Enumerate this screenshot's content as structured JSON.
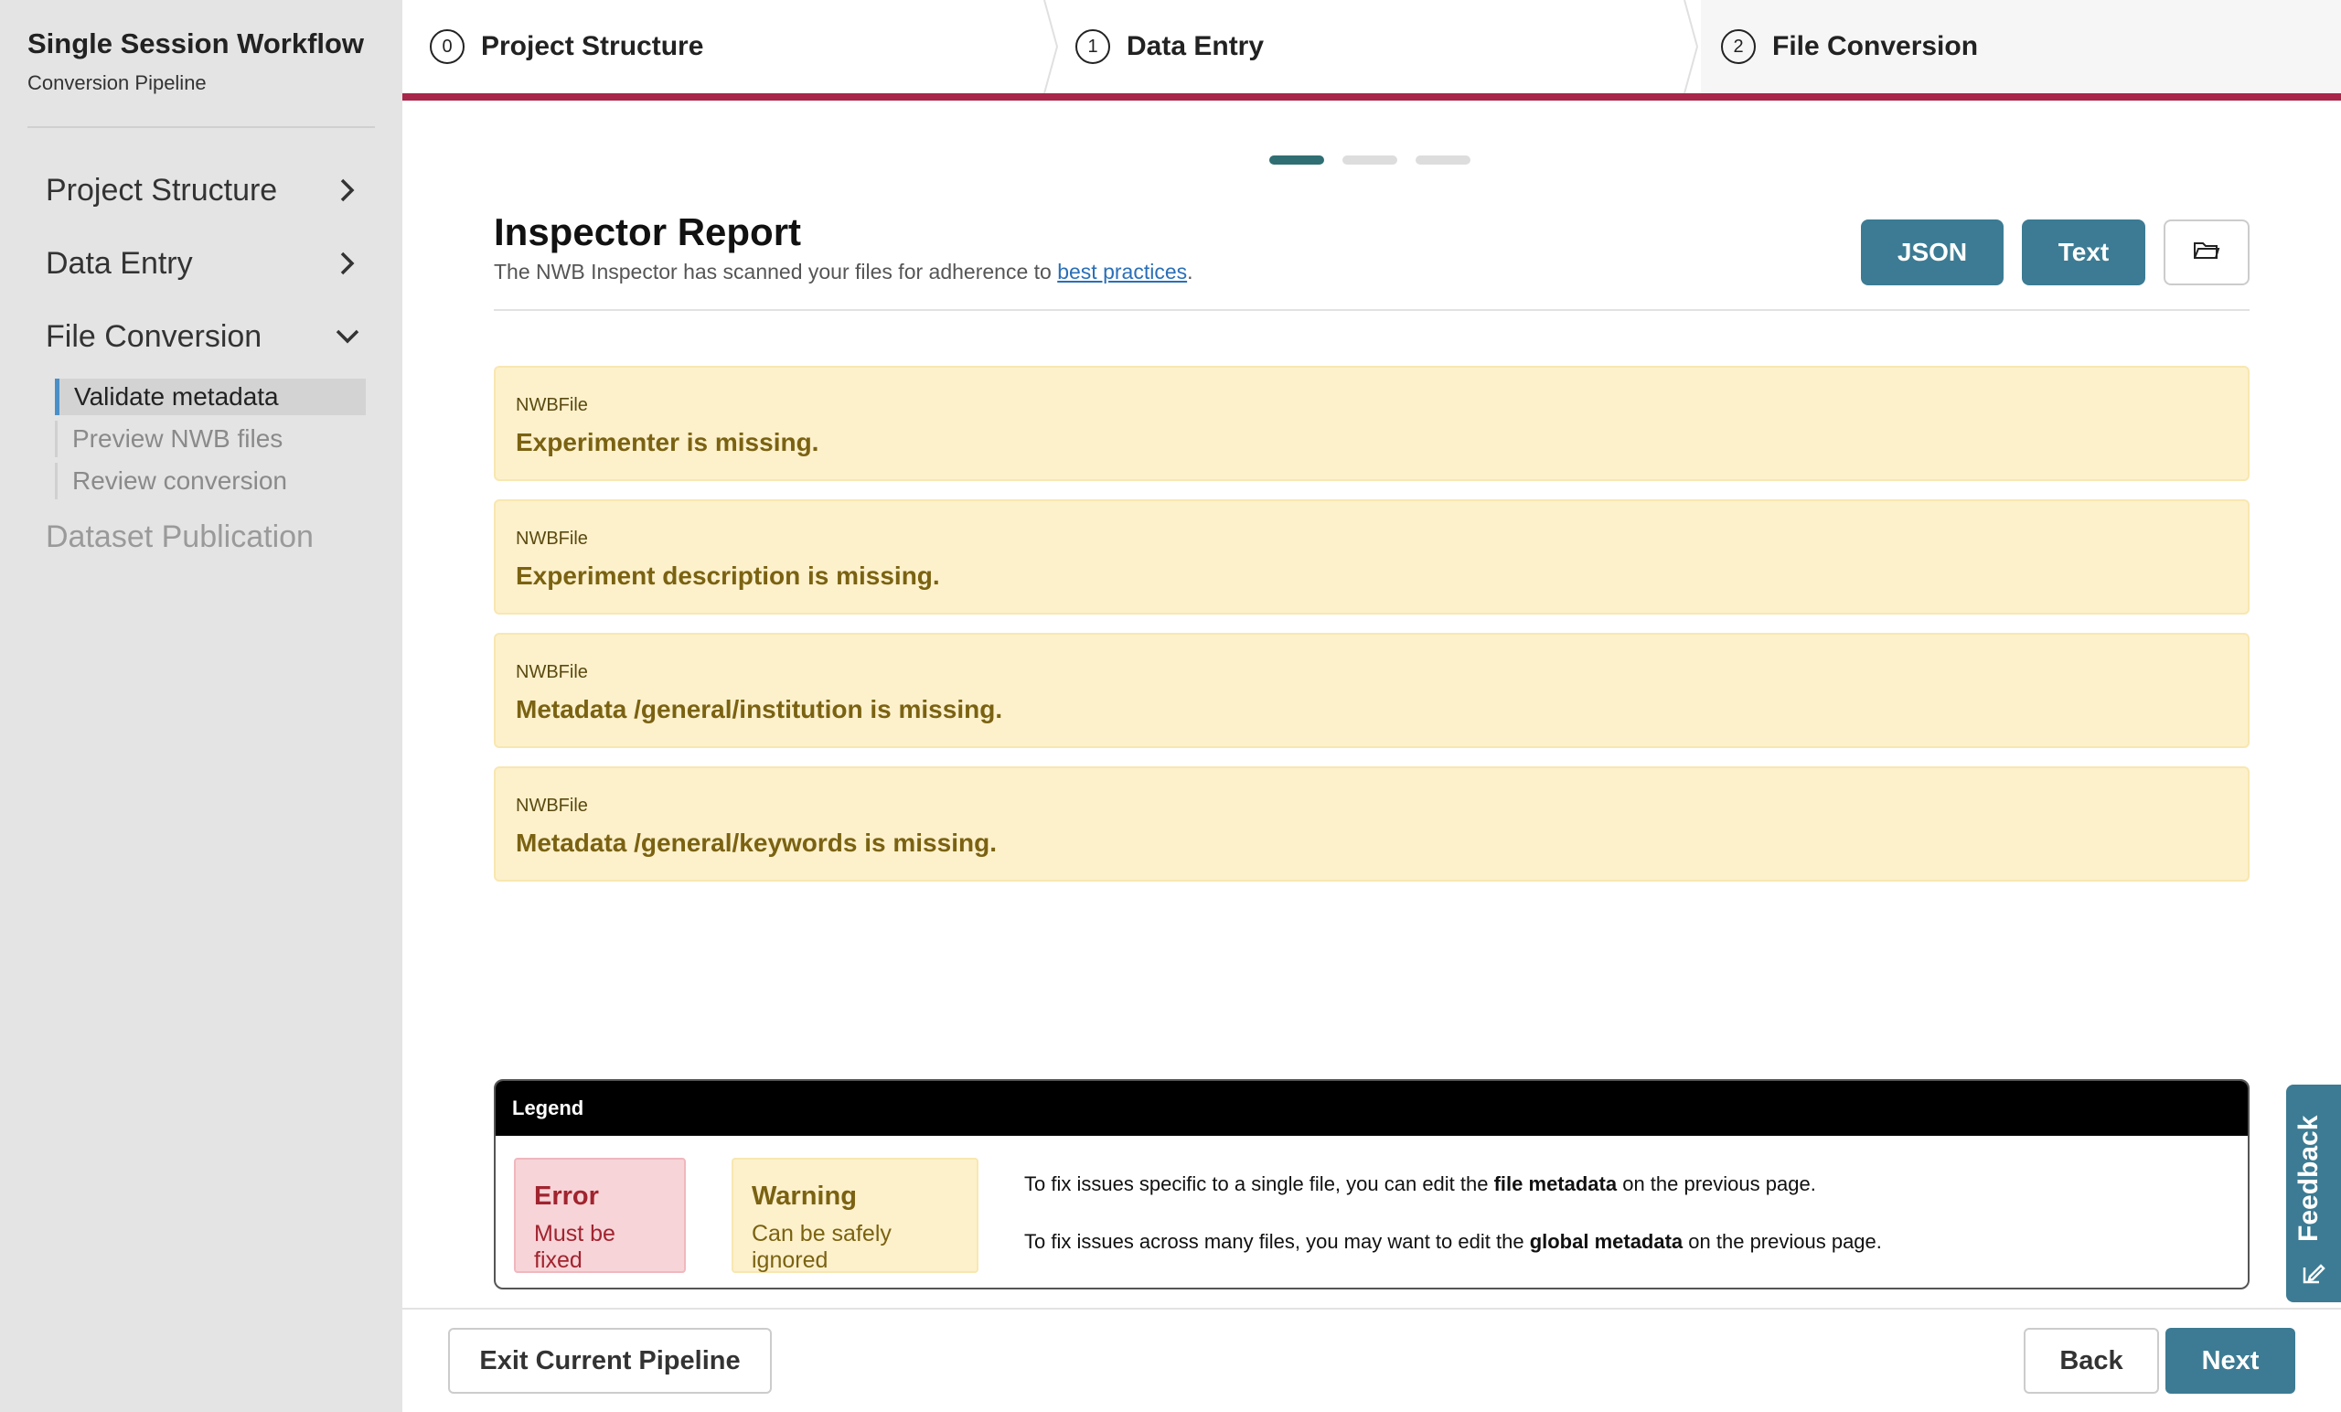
{
  "sidebar": {
    "title": "Single Session Workflow",
    "subtitle": "Conversion Pipeline",
    "items": [
      {
        "label": "Project Structure"
      },
      {
        "label": "Data Entry"
      },
      {
        "label": "File Conversion"
      },
      {
        "label": "Dataset Publication"
      }
    ],
    "sub_items": [
      {
        "label": "Validate metadata"
      },
      {
        "label": "Preview NWB files"
      },
      {
        "label": "Review conversion"
      }
    ]
  },
  "stepper": {
    "steps": [
      {
        "num": "0",
        "label": "Project Structure"
      },
      {
        "num": "1",
        "label": "Data Entry"
      },
      {
        "num": "2",
        "label": "File Conversion"
      }
    ],
    "accent_color": "#a8264a"
  },
  "report": {
    "title": "Inspector Report",
    "description_prefix": "The NWB Inspector has scanned your files for adherence to ",
    "description_link": "best practices",
    "description_suffix": ".",
    "json_button": "JSON",
    "text_button": "Text",
    "folder_icon": "folder-icon"
  },
  "messages": [
    {
      "type": "NWBFile",
      "text": "Experimenter is missing."
    },
    {
      "type": "NWBFile",
      "text": "Experiment description is missing."
    },
    {
      "type": "NWBFile",
      "text": "Metadata /general/institution is missing."
    },
    {
      "type": "NWBFile",
      "text": "Metadata /general/keywords is missing."
    }
  ],
  "legend": {
    "title": "Legend",
    "error_title": "Error",
    "error_sub": "Must be fixed",
    "warning_title": "Warning",
    "warning_sub": "Can be safely ignored",
    "info1_prefix": "To fix issues specific to a single file, you can edit the ",
    "info1_bold": "file metadata",
    "info1_suffix": " on the previous page.",
    "info2_prefix": "To fix issues across many files, you may want to edit the ",
    "info2_bold": "global metadata",
    "info2_suffix": " on the previous page."
  },
  "footer": {
    "exit_label": "Exit Current Pipeline",
    "back_label": "Back",
    "next_label": "Next"
  },
  "feedback": {
    "label": "Feedback"
  },
  "colors": {
    "teal": "#3c7b93",
    "warning_bg": "#fdf1cc",
    "error_bg": "#f7d4d8"
  }
}
